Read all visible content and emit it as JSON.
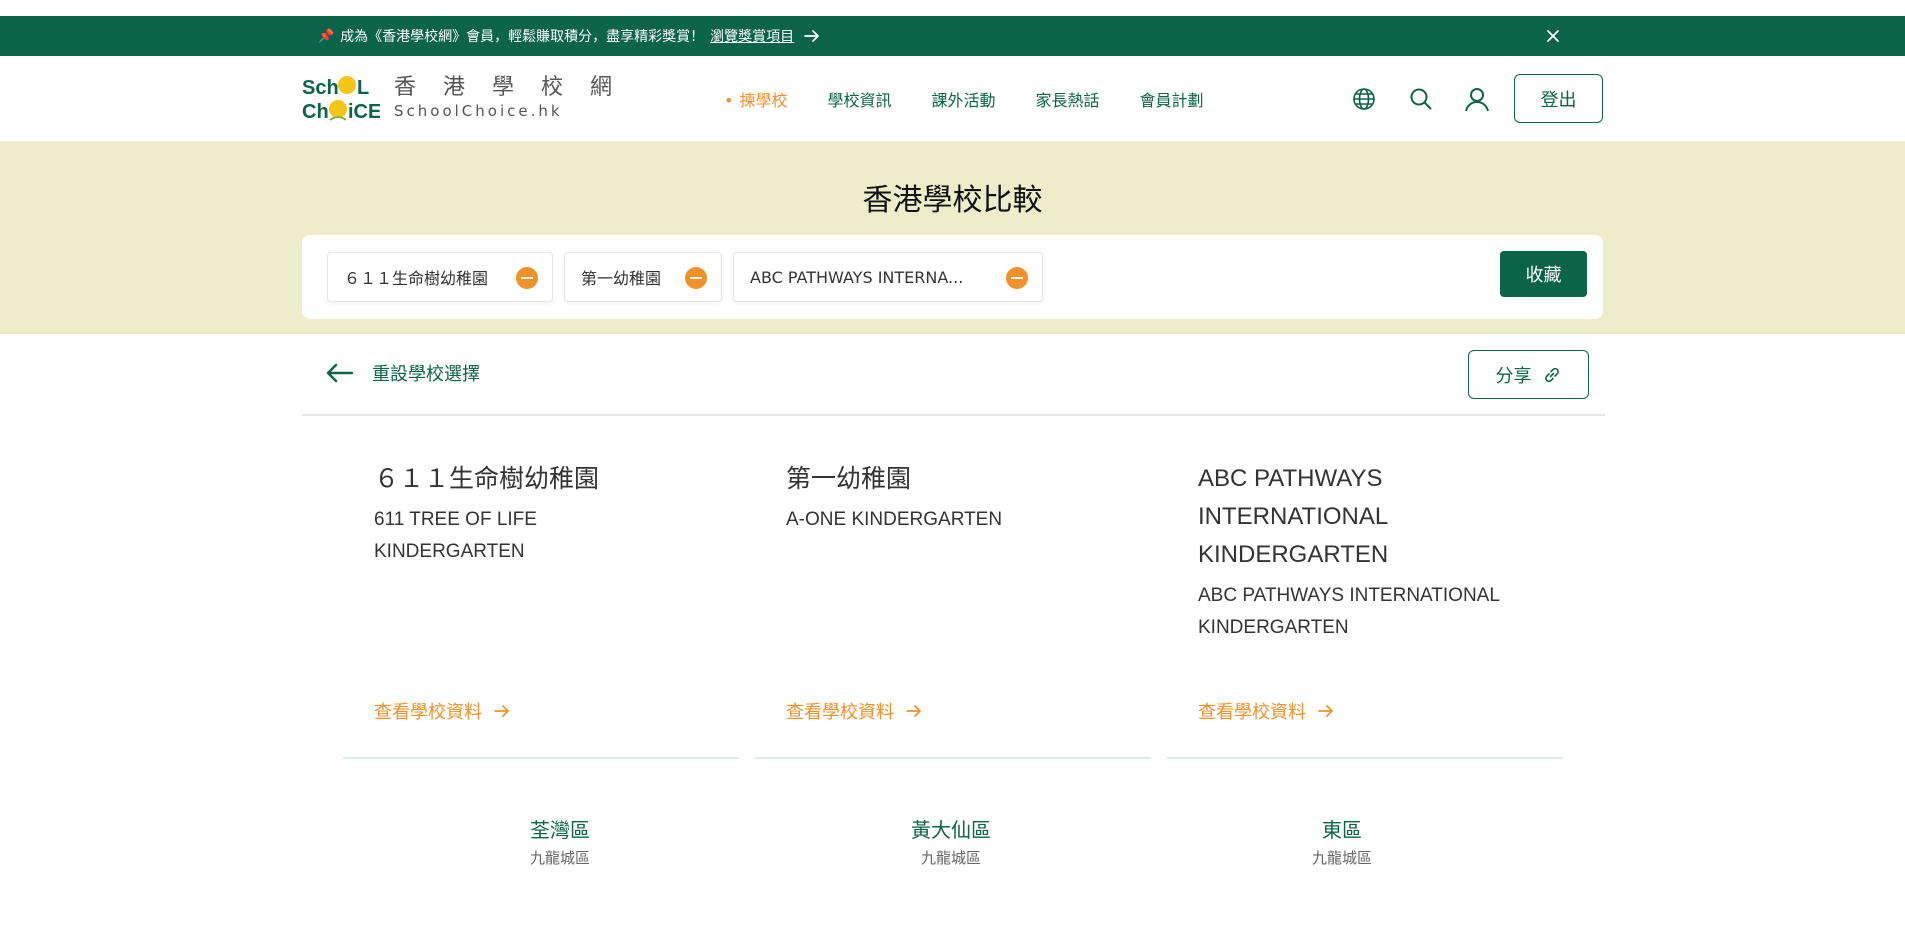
{
  "banner": {
    "pin_icon": "pushpin-icon",
    "text": "成為《香港學校網》會員，輕鬆賺取積分，盡享精彩獎賞！",
    "link": "瀏覽獎賞項目"
  },
  "header": {
    "logo_zh": "香 港 學 校 網",
    "logo_en": "SchoolChoice.hk",
    "nav": [
      "揀學校",
      "學校資訊",
      "課外活動",
      "家長熱話",
      "會員計劃"
    ],
    "logout": "登出"
  },
  "hero": {
    "title": "香港學校比較",
    "chips": [
      "６１１生命樹幼稚園",
      "第一幼稚園",
      "ABC PATHWAYS INTERNA..."
    ],
    "favorite": "收藏"
  },
  "toolbar": {
    "reset": "重設學校選擇",
    "share": "分享"
  },
  "schools": [
    {
      "name_zh": "６１１生命樹幼稚園",
      "name_en_lines": [
        "611 TREE OF LIFE",
        "KINDERGARTEN"
      ],
      "more": "查看學校資料",
      "district": "荃灣區",
      "region": "九龍城區"
    },
    {
      "name_zh": "第一幼稚園",
      "name_en_lines": [
        "A-ONE KINDERGARTEN"
      ],
      "more": "查看學校資料",
      "district": "黃大仙區",
      "region": "九龍城區"
    },
    {
      "title_lines": [
        "ABC PATHWAYS",
        "INTERNATIONAL",
        "KINDERGARTEN"
      ],
      "name_en_lines": [
        "ABC PATHWAYS INTERNATIONAL",
        "KINDERGARTEN"
      ],
      "more": "查看學校資料",
      "district": "東區",
      "region": "九龍城區"
    }
  ],
  "colors": {
    "brand_green": "#0b634a",
    "accent_orange": "#f2912b",
    "hero_bg": "#edeec9"
  }
}
